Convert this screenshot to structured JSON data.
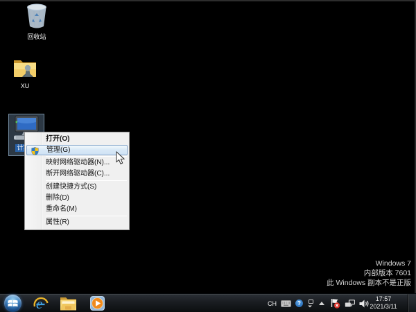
{
  "desktop": {
    "icons": {
      "recycle_bin": "回收站",
      "user_folder": "XU",
      "computer": "计算机"
    },
    "watermark": {
      "line1": "Windows 7",
      "line2": "内部版本 7601",
      "line3": "此 Windows 副本不是正版"
    }
  },
  "context_menu": {
    "open": "打开(O)",
    "manage": "管理(G)",
    "map_network_drive": "映射网络驱动器(N)...",
    "disconnect_network_drive": "断开网络驱动器(C)...",
    "create_shortcut": "创建快捷方式(S)",
    "delete": "删除(D)",
    "rename": "重命名(M)",
    "properties": "属性(R)"
  },
  "taskbar": {
    "tray": {
      "input_indicator": "CH",
      "help_glyph": "?",
      "time": "17:57",
      "date": "2021/3/11"
    }
  },
  "icon_names": {
    "start": "windows-start-orb",
    "pinned": [
      "internet-explorer",
      "windows-explorer-folder",
      "windows-media-player"
    ],
    "tray": [
      "keyboard",
      "help",
      "language-options",
      "show-hidden-icons",
      "action-center-flag-error",
      "network",
      "volume"
    ]
  },
  "colors": {
    "desktop_background": "#000000",
    "selection_fill": "rgba(125,160,195,0.35)",
    "menu_highlight_border": "#86a7cc",
    "uac_shield_blue": "#2d7ac7",
    "uac_shield_yellow": "#f5c518",
    "ie_blue": "#2f8fd6",
    "wmp_orange": "#f08a1d",
    "action_center_error": "#d9312a"
  }
}
